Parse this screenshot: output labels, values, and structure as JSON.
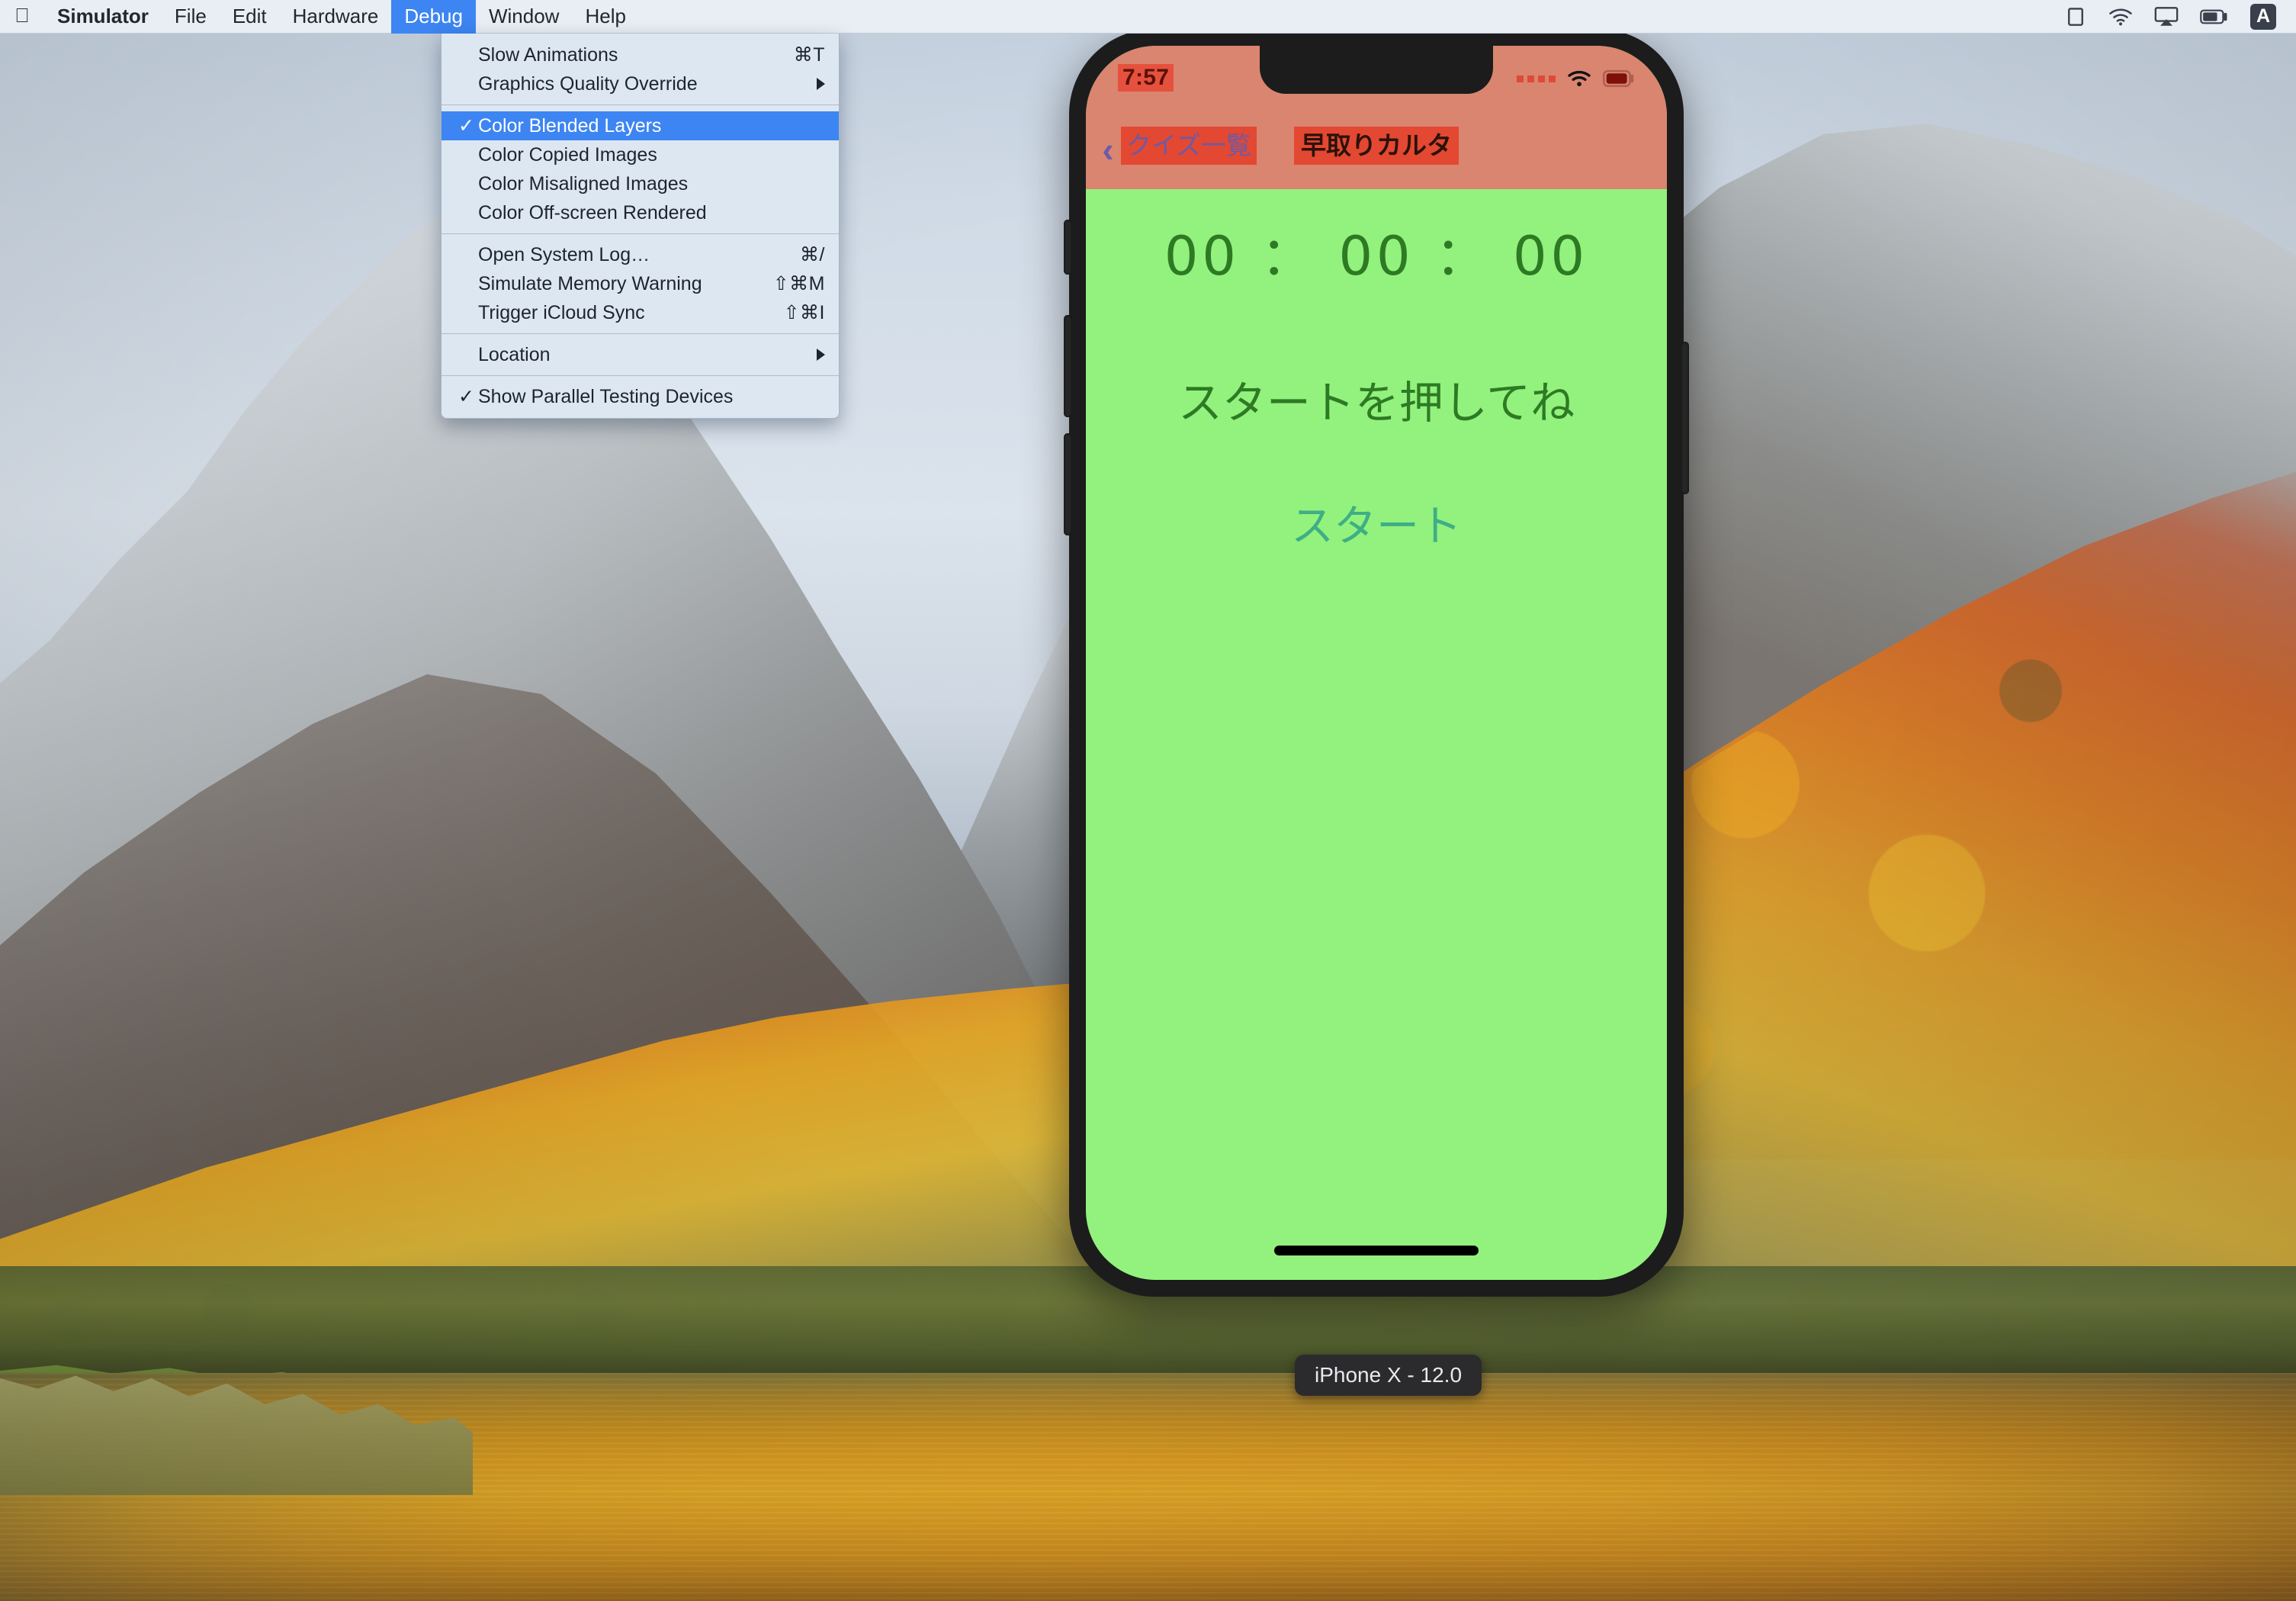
{
  "menubar": {
    "apple_icon": "apple-logo-icon",
    "items": [
      {
        "label": "Simulator",
        "bold": true,
        "active": false
      },
      {
        "label": "File",
        "bold": false,
        "active": false
      },
      {
        "label": "Edit",
        "bold": false,
        "active": false
      },
      {
        "label": "Hardware",
        "bold": false,
        "active": false
      },
      {
        "label": "Debug",
        "bold": false,
        "active": true
      },
      {
        "label": "Window",
        "bold": false,
        "active": false
      },
      {
        "label": "Help",
        "bold": false,
        "active": false
      }
    ],
    "status_icons": [
      "screen-mirroring-icon",
      "wifi-icon",
      "airplay-icon",
      "battery-icon",
      "input-source-icon"
    ],
    "input_source_label": "A",
    "highlight_color": "#3d85f2",
    "background_color": "#e9eef4"
  },
  "debug_menu": {
    "title": "Debug",
    "groups": [
      {
        "items": [
          {
            "label": "Slow Animations",
            "shortcut": "⌘T",
            "checked": false,
            "submenu": false,
            "selected": false
          },
          {
            "label": "Graphics Quality Override",
            "shortcut": "",
            "checked": false,
            "submenu": true,
            "selected": false
          }
        ]
      },
      {
        "items": [
          {
            "label": "Color Blended Layers",
            "shortcut": "",
            "checked": true,
            "submenu": false,
            "selected": true
          },
          {
            "label": "Color Copied Images",
            "shortcut": "",
            "checked": false,
            "submenu": false,
            "selected": false
          },
          {
            "label": "Color Misaligned Images",
            "shortcut": "",
            "checked": false,
            "submenu": false,
            "selected": false
          },
          {
            "label": "Color Off-screen Rendered",
            "shortcut": "",
            "checked": false,
            "submenu": false,
            "selected": false
          }
        ]
      },
      {
        "items": [
          {
            "label": "Open System Log…",
            "shortcut": "⌘/",
            "checked": false,
            "submenu": false,
            "selected": false
          },
          {
            "label": "Simulate Memory Warning",
            "shortcut": "⇧⌘M",
            "checked": false,
            "submenu": false,
            "selected": false
          },
          {
            "label": "Trigger iCloud Sync",
            "shortcut": "⇧⌘I",
            "checked": false,
            "submenu": false,
            "selected": false
          }
        ]
      },
      {
        "items": [
          {
            "label": "Location",
            "shortcut": "",
            "checked": false,
            "submenu": true,
            "selected": false
          }
        ]
      },
      {
        "items": [
          {
            "label": "Show Parallel Testing Devices",
            "shortcut": "",
            "checked": true,
            "submenu": false,
            "selected": false
          }
        ]
      }
    ],
    "check_glyph": "✓"
  },
  "simulator": {
    "device_label": "iPhone X - 12.0",
    "status_bar": {
      "time": "7:57",
      "time_bg": "#E6513E",
      "bar_bg": "#D98570",
      "icons": [
        "cellular-signal-icon",
        "wifi-icon",
        "battery-icon"
      ]
    },
    "nav_bar": {
      "back_chevron": "‹",
      "back_label": "クイズ一覧",
      "title": "早取りカルタ",
      "bg": "#D98570",
      "label_bg": "#E34832",
      "back_text_color": "#6B5BA8"
    },
    "content": {
      "timer": "00 ： 00 ： 00",
      "prompt": "スタートを押してね",
      "start_button": "スタート",
      "background": "#92F27D",
      "text_color": "#2E7A24",
      "button_color": "#3FAE86"
    },
    "hardware_buttons": [
      "silent-switch",
      "volume-up-button",
      "volume-down-button",
      "power-button"
    ]
  }
}
